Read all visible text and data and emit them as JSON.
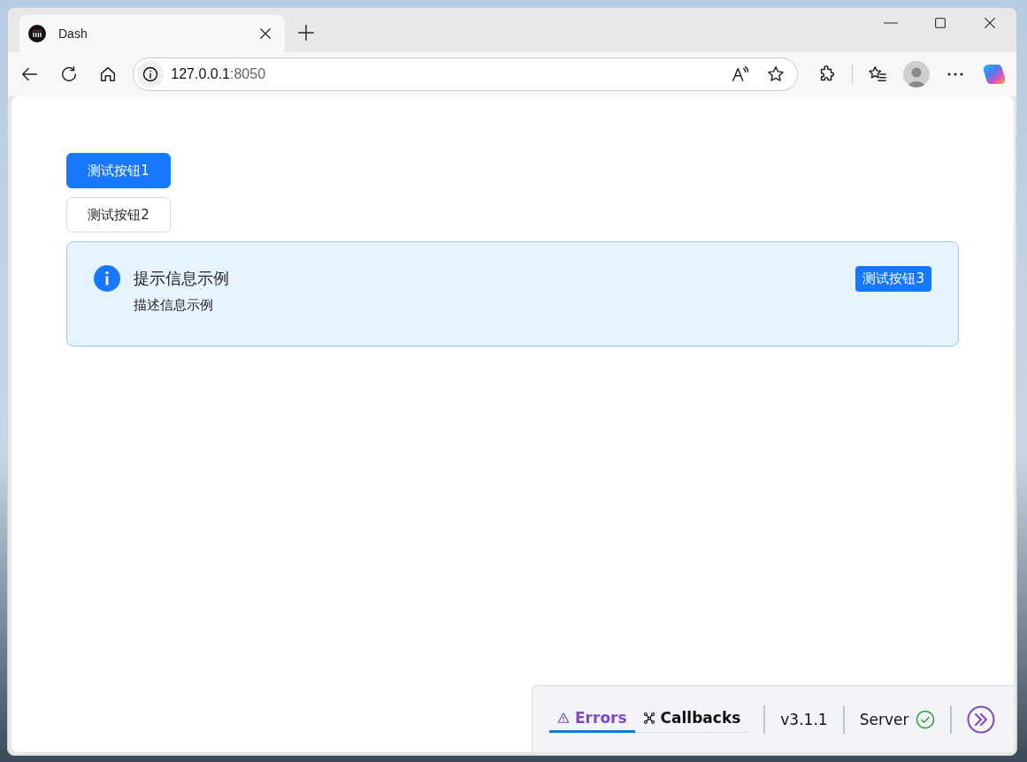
{
  "browser": {
    "tabs": [
      {
        "title": "Dash",
        "selected": true
      }
    ],
    "address": {
      "host": "127.0.0.1",
      "port": ":8050"
    }
  },
  "page": {
    "buttons": [
      {
        "label": "测试按钮1",
        "kind": "primary"
      },
      {
        "label": "测试按钮2",
        "kind": "default"
      }
    ],
    "alert": {
      "title": "提示信息示例",
      "description": "描述信息示例",
      "action": "测试按钮3"
    }
  },
  "devtools": {
    "tabs": [
      {
        "label": "Errors",
        "selected": true
      },
      {
        "label": "Callbacks",
        "selected": false
      }
    ],
    "version": "v3.1.1",
    "server": {
      "label": "Server",
      "ok": true
    }
  }
}
